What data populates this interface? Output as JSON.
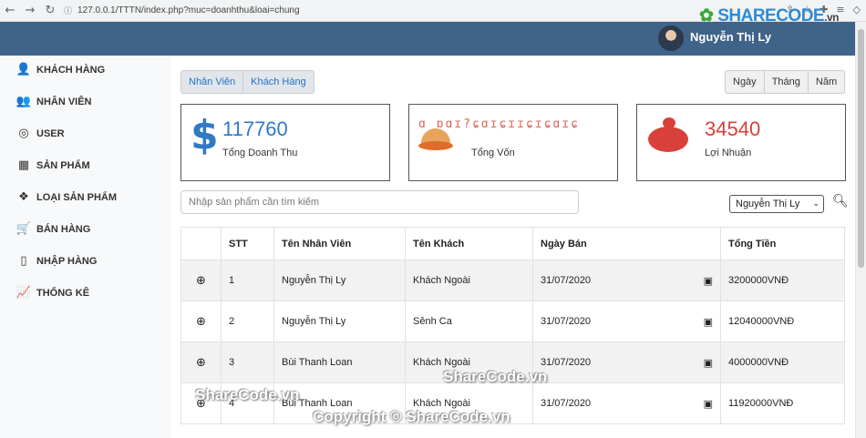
{
  "browser": {
    "url": "127.0.0.1/TTTN/index.php?muc=doanhthu&loai=chung",
    "logo_text": "SHARECODE",
    "logo_suffix": ".vn"
  },
  "header": {
    "user_name": "Nguyễn Thị Ly"
  },
  "sidebar": {
    "items": [
      {
        "label": "KHÁCH HÀNG",
        "icon": "user-plus-icon"
      },
      {
        "label": "NHÂN VIÊN",
        "icon": "user-cog-icon"
      },
      {
        "label": "USER",
        "icon": "user-circle-icon"
      },
      {
        "label": "SẢN PHẨM",
        "icon": "boxes-icon"
      },
      {
        "label": "LOẠI SẢN PHẨM",
        "icon": "dropbox-icon"
      },
      {
        "label": "BÁN HÀNG",
        "icon": "cart-icon"
      },
      {
        "label": "NHẬP HÀNG",
        "icon": "clipboard-icon"
      },
      {
        "label": "THỐNG KÊ",
        "icon": "chart-line-icon"
      }
    ]
  },
  "filters": {
    "left": [
      "Nhân Viên",
      "Khách Hàng"
    ],
    "right": [
      "Ngày",
      "Tháng",
      "Năm"
    ]
  },
  "cards": [
    {
      "value": "117760",
      "label": "Tổng Doanh Thu",
      "color": "#2f79c7"
    },
    {
      "value": "",
      "label": "Tổng Vốn",
      "color": "#d04b3a"
    },
    {
      "value": "34540",
      "label": "Lợi Nhuận",
      "color": "#d9403a"
    }
  ],
  "search": {
    "placeholder": "Nhập sản phẩm cần tìm kiếm"
  },
  "employee_select": "Nguyễn Thị Ly",
  "table": {
    "headers": [
      "",
      "STT",
      "Tên Nhân Viên",
      "Tên Khách",
      "Ngày Bán",
      "Tổng Tiền"
    ],
    "rows": [
      {
        "stt": "1",
        "employee": "Nguyễn Thị Ly",
        "customer": "Khách Ngoài",
        "date": "31/07/2020",
        "total": "3200000VNĐ"
      },
      {
        "stt": "2",
        "employee": "Nguyễn Thị Ly",
        "customer": "Sênh Ca",
        "date": "31/07/2020",
        "total": "12040000VNĐ"
      },
      {
        "stt": "3",
        "employee": "Bùi Thanh Loan",
        "customer": "Khách Ngoài",
        "date": "31/07/2020",
        "total": "4000000VNĐ"
      },
      {
        "stt": "4",
        "employee": "Bùi Thanh Loan",
        "customer": "Khách Ngoài",
        "date": "31/07/2020",
        "total": "11920000VNĐ"
      }
    ]
  },
  "watermarks": [
    "ShareCode.vn",
    "ShareCode.vn",
    "Copyright © ShareCode.vn"
  ]
}
